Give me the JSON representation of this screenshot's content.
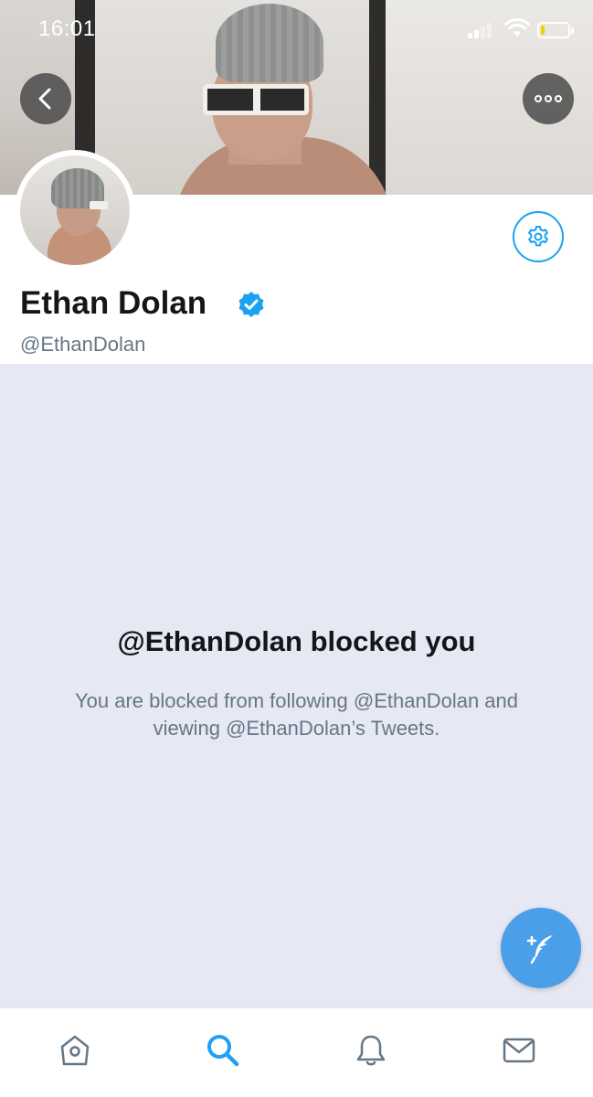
{
  "status_bar": {
    "time": "16:01"
  },
  "profile": {
    "display_name": "Ethan Dolan",
    "handle": "@EthanDolan",
    "verified": true
  },
  "blocked": {
    "title": "@EthanDolan blocked you",
    "message": "You are blocked from following @EthanDolan and viewing @EthanDolan’s Tweets."
  },
  "icons": {
    "back": "chevron-left-icon",
    "more": "more-dots-icon",
    "settings": "gear-icon",
    "verified": "verified-badge-icon",
    "compose": "compose-tweet-icon",
    "home": "home-icon",
    "search": "search-icon",
    "notifications": "bell-icon",
    "messages": "envelope-icon"
  },
  "colors": {
    "accent": "#1da1f2",
    "active_tab": "#1da1f2",
    "inactive_tab": "#657786",
    "blocked_panel_bg": "#e6e8f3",
    "battery_level": "#f5d000"
  },
  "battery_level": 0.15
}
